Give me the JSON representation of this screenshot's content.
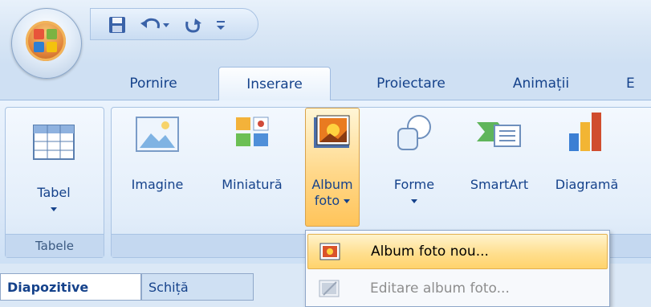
{
  "tabs": [
    {
      "label": "Pornire"
    },
    {
      "label": "Inserare"
    },
    {
      "label": "Proiectare"
    },
    {
      "label": "Animații"
    },
    {
      "label": "E"
    }
  ],
  "ribbon": {
    "tabel_label": "Tabel",
    "imagine_label": "Imagine",
    "miniatura_label": "Miniatură",
    "album_line1": "Album",
    "album_line2": "foto",
    "forme_label": "Forme",
    "smartart_label": "SmartArt",
    "diagrama_label": "Diagramă",
    "group_tabele": "Tabele"
  },
  "dropdown": {
    "item1": "Album foto nou...",
    "item2": "Editare album foto..."
  },
  "panel_tabs": {
    "diapozitive": "Diapozitive",
    "schita": "Schiță"
  },
  "colors": {
    "accent_text": "#15428b",
    "highlight": "#ffd88a",
    "ribbon_bg": "#dfeaf8"
  },
  "icons": [
    "office-button-icon",
    "save-icon",
    "undo-icon",
    "redo-icon",
    "customize-qat-icon",
    "table-icon",
    "picture-icon",
    "clipart-icon",
    "photo-album-icon",
    "shapes-icon",
    "smartart-icon",
    "chart-icon",
    "new-album-icon",
    "edit-album-icon"
  ]
}
